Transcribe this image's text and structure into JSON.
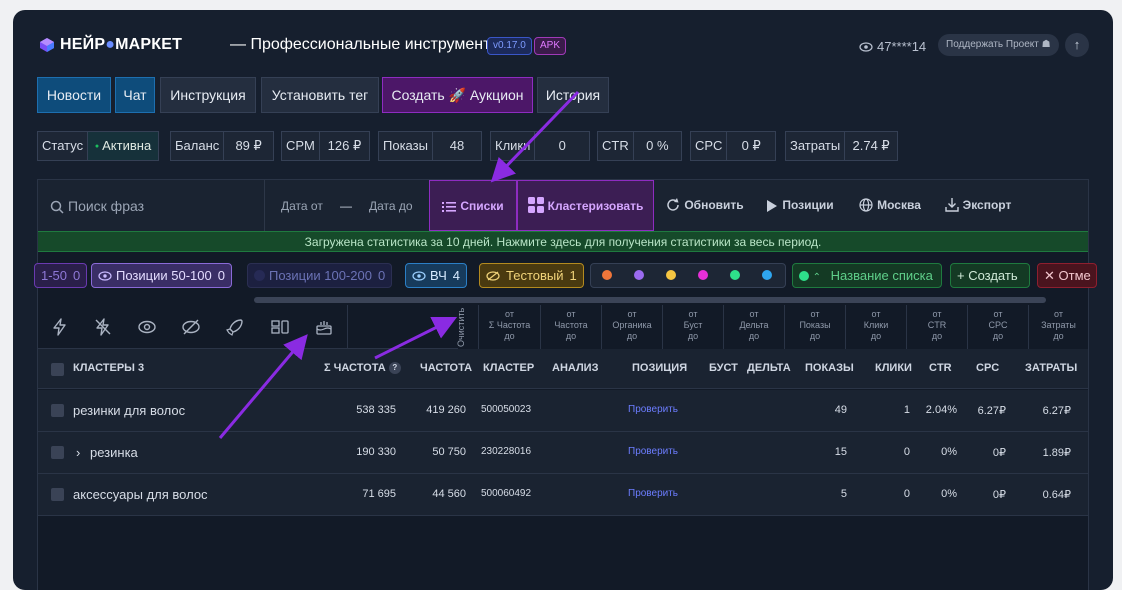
{
  "header": {
    "brand_prefix": "НЕЙР",
    "brand_mid": "●",
    "brand_suffix": "МАРКЕТ",
    "subtitle": "— Профессиональные инструменты",
    "version": "v0.17.0",
    "apk": "APK",
    "user": "47****14",
    "support": "Поддержать Проект",
    "up_icon": "arrow-up-icon"
  },
  "nav": [
    "Новости",
    "Чат",
    "Инструкция",
    "Установить тег",
    "Создать 🚀 Аукцион",
    "История"
  ],
  "stats": [
    {
      "label": "Статус",
      "value": "Активна"
    },
    {
      "label": "Баланс",
      "value": "89 ₽"
    },
    {
      "label": "CPM",
      "value": "126 ₽"
    },
    {
      "label": "Показы",
      "value": "48"
    },
    {
      "label": "Клики",
      "value": "0"
    },
    {
      "label": "CTR",
      "value": "0 %"
    },
    {
      "label": "CPC",
      "value": "0 ₽"
    },
    {
      "label": "Затраты",
      "value": "2.74 ₽"
    }
  ],
  "toolbar": {
    "search_placeholder": "Поиск фраз",
    "date_from": "Дата от",
    "dash": "—",
    "date_to": "Дата до",
    "lists": "Списки",
    "cluster": "Кластеризовать",
    "refresh": "Обновить",
    "positions": "Позиции",
    "region": "Москва",
    "export": "Экспорт"
  },
  "notice": "Загружена статистика за 10 дней. Нажмите здесь для получения статистики за весь период.",
  "chips": {
    "c1_label": "1-50",
    "c1_count": "0",
    "c2_label": "Позиции 50-100",
    "c2_count": "0",
    "c3_label": "Позиции 100-200",
    "c3_count": "0",
    "c4_label": "ВЧ",
    "c4_count": "4",
    "c5_label": "Тестовый",
    "c5_count": "1",
    "list_name_placeholder": "Название списка",
    "create": "+ Создать",
    "cancel": "✕ Отме"
  },
  "colors": {
    "accent_purple": "#8e2cc1",
    "accent_blue": "#1d6fb0",
    "green": "#1bbf5e",
    "dots": [
      "#f0763a",
      "#9b6bf0",
      "#f5c542",
      "#e62fd8",
      "#2ee08a",
      "#2fa6f0"
    ]
  },
  "filters": {
    "clear": "Очистить",
    "from": "от",
    "to": "до",
    "cols": [
      "Σ Частота",
      "Частота",
      "Органика",
      "Буст",
      "Дельта",
      "Показы",
      "Клики",
      "CTR",
      "CPC",
      "Затраты"
    ]
  },
  "table": {
    "clusters_label": "КЛАСТЕРЫ",
    "clusters_count": "3",
    "cols": {
      "sum_freq": "Σ ЧАСТОТА",
      "q": "?",
      "freq": "ЧАСТОТА",
      "cluster": "КЛАСТЕР",
      "analysis": "АНАЛИЗ",
      "position": "ПОЗИЦИЯ",
      "boost": "БУСТ",
      "delta": "ДЕЛЬТА",
      "impressions": "ПОКАЗЫ",
      "clicks": "КЛИКИ",
      "ctr": "CTR",
      "cpc": "CPC",
      "cost": "ЗАТРАТЫ"
    },
    "rows": [
      {
        "expander": "",
        "name": "резинки для волос",
        "sum": "538 335",
        "freq": "419 260",
        "cluster": "500050023",
        "pos": "Проверить",
        "imp": "49",
        "clicks": "1",
        "ctr": "2.04%",
        "cpc": "6.27₽",
        "cost": "6.27₽"
      },
      {
        "expander": "›",
        "name": "резинка",
        "sum": "190 330",
        "freq": "50 750",
        "cluster": "230228016",
        "pos": "Проверить",
        "imp": "15",
        "clicks": "0",
        "ctr": "0%",
        "cpc": "0₽",
        "cost": "1.89₽"
      },
      {
        "expander": "",
        "name": "аксессуары для волос",
        "sum": "71 695",
        "freq": "44 560",
        "cluster": "500060492",
        "pos": "Проверить",
        "imp": "5",
        "clicks": "0",
        "ctr": "0%",
        "cpc": "0₽",
        "cost": "0.64₽"
      }
    ]
  }
}
